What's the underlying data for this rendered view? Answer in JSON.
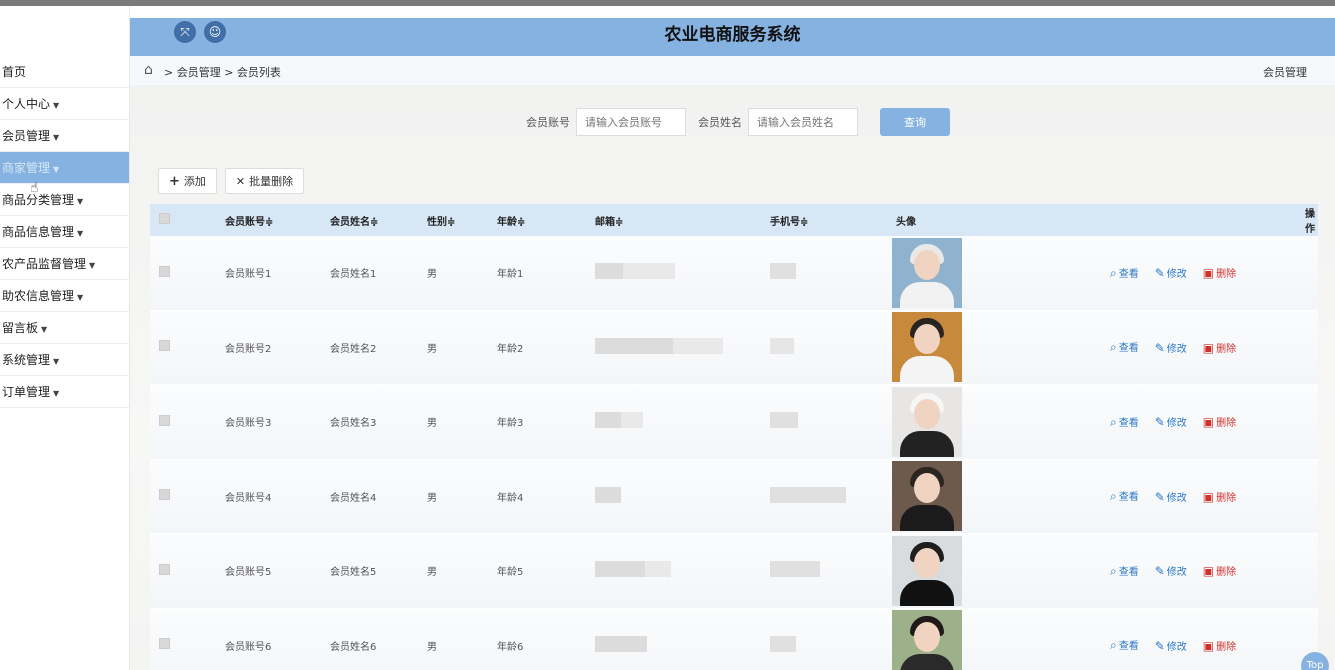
{
  "header": {
    "title": "农业电商服务系统"
  },
  "breadcrumb": {
    "path": "> 会员管理 > 会员列表",
    "right_label": "会员管理"
  },
  "sidebar": {
    "items": [
      {
        "label": "首页",
        "caret": false
      },
      {
        "label": "个人中心",
        "caret": true
      },
      {
        "label": "会员管理",
        "caret": true
      },
      {
        "label": "商家管理",
        "caret": true,
        "active": true
      },
      {
        "label": "商品分类管理",
        "caret": true
      },
      {
        "label": "商品信息管理",
        "caret": true
      },
      {
        "label": "农产品监督管理",
        "caret": true
      },
      {
        "label": "助农信息管理",
        "caret": true
      },
      {
        "label": "留言板",
        "caret": true
      },
      {
        "label": "系统管理",
        "caret": true
      },
      {
        "label": "订单管理",
        "caret": true
      }
    ]
  },
  "search": {
    "account_label": "会员账号",
    "account_placeholder": "请输入会员账号",
    "name_label": "会员姓名",
    "name_placeholder": "请输入会员姓名",
    "query_button": "查询"
  },
  "actions": {
    "add": "添加",
    "batch_delete": "批量删除"
  },
  "table": {
    "headers": [
      "会员账号≑",
      "会员姓名≑",
      "性别≑",
      "年龄≑",
      "邮箱≑",
      "手机号≑",
      "头像",
      "操作"
    ],
    "rows": [
      {
        "account": "会员账号1",
        "name": "会员姓名1",
        "sex": "男",
        "age": "年龄1"
      },
      {
        "account": "会员账号2",
        "name": "会员姓名2",
        "sex": "男",
        "age": "年龄2"
      },
      {
        "account": "会员账号3",
        "name": "会员姓名3",
        "sex": "男",
        "age": "年龄3"
      },
      {
        "account": "会员账号4",
        "name": "会员姓名4",
        "sex": "男",
        "age": "年龄4"
      },
      {
        "account": "会员账号5",
        "name": "会员姓名5",
        "sex": "男",
        "age": "年龄5"
      },
      {
        "account": "会员账号6",
        "name": "会员姓名6",
        "sex": "男",
        "age": "年龄6"
      }
    ],
    "ops": {
      "view": "查看",
      "edit": "修改",
      "delete": "删除"
    }
  },
  "top_button": "Top",
  "colors": {
    "accent": "#86b2e2",
    "view": "#2b78c5",
    "delete": "#d0312d"
  }
}
